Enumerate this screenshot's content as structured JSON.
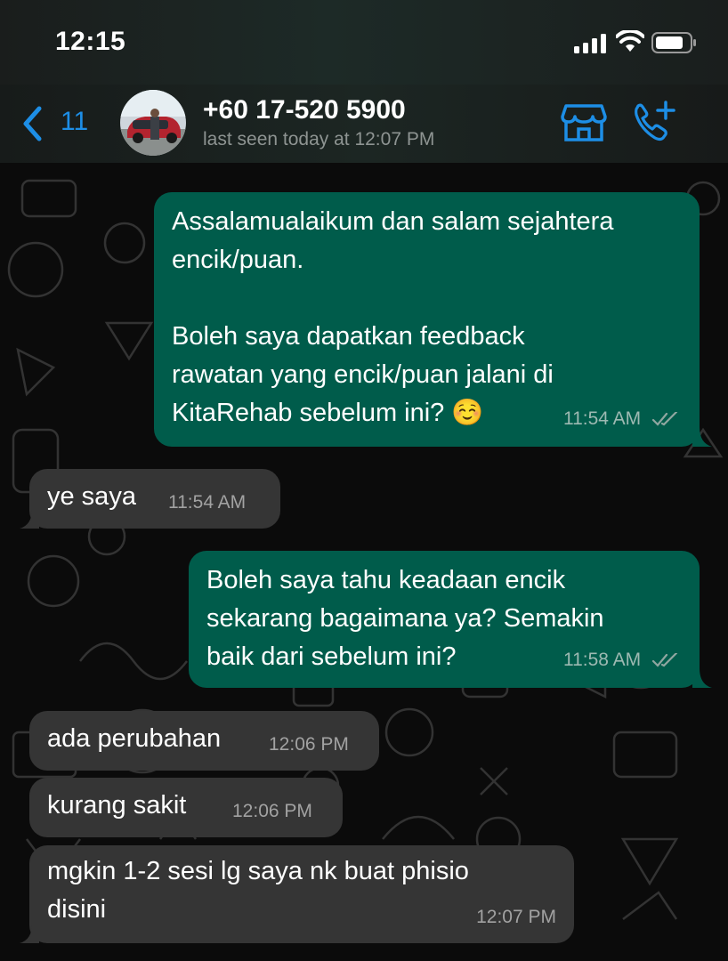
{
  "status_bar": {
    "time": "12:15"
  },
  "header": {
    "back_count": "11",
    "contact_name": "+60 17-520 5900",
    "last_seen": "last seen today at 12:07 PM"
  },
  "messages": [
    {
      "direction": "out",
      "text": "Assalamualaikum dan salam sejahtera\nencik/puan.\n\nBoleh saya dapatkan feedback\nrawatan yang encik/puan jalani di\nKitaRehab sebelum ini? ☺️",
      "time": "11:54 AM",
      "status": "read"
    },
    {
      "direction": "in",
      "text": "ye saya",
      "time": "11:54 AM"
    },
    {
      "direction": "out",
      "text": "Boleh saya tahu keadaan encik\nsekarang bagaimana ya? Semakin\nbaik dari sebelum ini?",
      "time": "11:58 AM",
      "status": "read"
    },
    {
      "direction": "in",
      "text": "ada perubahan",
      "time": "12:06 PM"
    },
    {
      "direction": "in",
      "text": "kurang sakit",
      "time": "12:06 PM"
    },
    {
      "direction": "in",
      "text": "mgkin 1-2 sesi lg saya nk buat phisio\ndisini",
      "time": "12:07 PM"
    }
  ],
  "icons": {
    "back": "chevron-left-icon",
    "store": "storefront-icon",
    "call": "add-call-icon",
    "signal": "cellular-signal-icon",
    "wifi": "wifi-icon",
    "battery": "battery-icon",
    "read_receipt": "double-check-icon"
  },
  "colors": {
    "accent": "#1d8ee6",
    "outgoing_bubble": "#005c4b",
    "incoming_bubble": "#353535",
    "background": "#0b0b0b"
  }
}
